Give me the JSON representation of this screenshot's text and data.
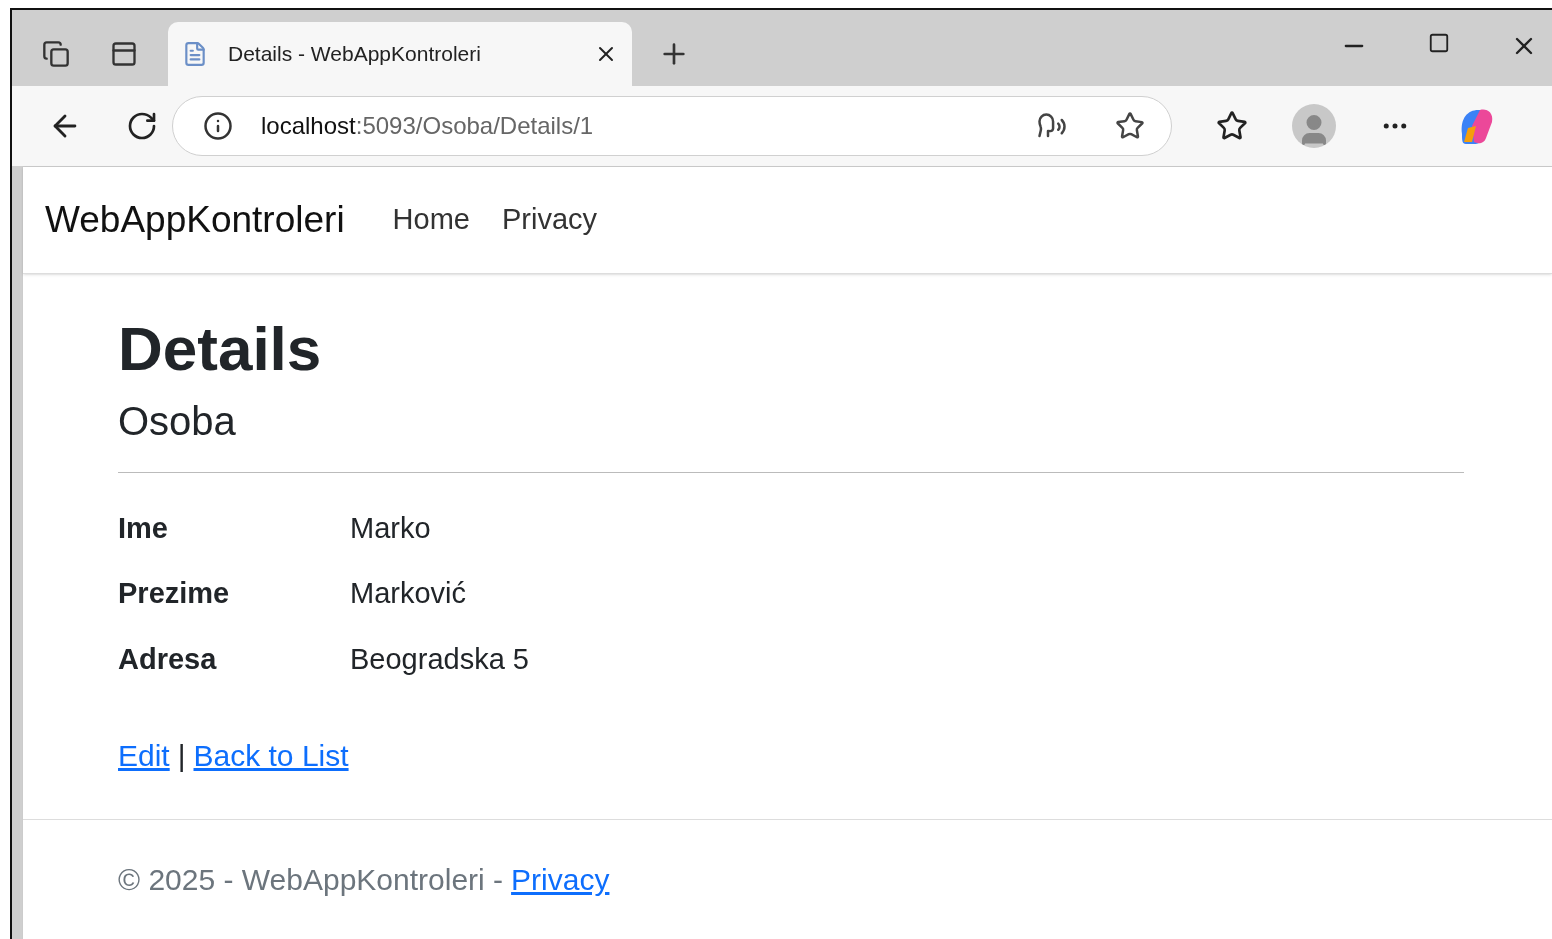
{
  "browser": {
    "tab": {
      "title": "Details - WebAppKontroleri"
    },
    "address": {
      "host": "localhost",
      "path": ":5093/Osoba/Details/1"
    }
  },
  "navbar": {
    "brand": "WebAppKontroleri",
    "links": [
      "Home",
      "Privacy"
    ]
  },
  "main": {
    "title": "Details",
    "subtitle": "Osoba",
    "fields": [
      {
        "label": "Ime",
        "value": "Marko"
      },
      {
        "label": "Prezime",
        "value": "Marković"
      },
      {
        "label": "Adresa",
        "value": "Beogradska 5"
      }
    ],
    "actions": {
      "edit": "Edit",
      "separator": "|",
      "back": "Back to List"
    }
  },
  "footer": {
    "text": "© 2025 - WebAppKontroleri -",
    "link": "Privacy"
  }
}
